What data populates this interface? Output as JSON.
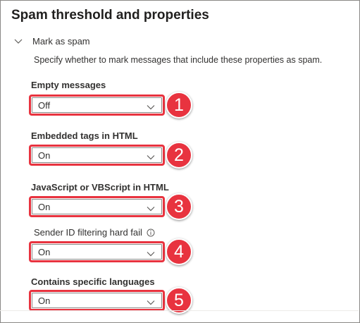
{
  "panel": {
    "title": "Spam threshold and properties"
  },
  "section": {
    "label": "Mark as spam",
    "description": "Specify whether to mark messages that include these properties as spam."
  },
  "fields": [
    {
      "label": "Empty messages",
      "value": "Off",
      "badge": "1"
    },
    {
      "label": "Embedded tags in HTML",
      "value": "On",
      "badge": "2"
    },
    {
      "label": "JavaScript or VBScript in HTML",
      "value": "On",
      "badge": "3"
    },
    {
      "label": "Sender ID filtering hard fail",
      "value": "On",
      "badge": "4"
    },
    {
      "label": "Contains specific languages",
      "value": "On",
      "badge": "5"
    }
  ],
  "colors": {
    "highlight": "#e8333f",
    "text": "#323130",
    "border": "#8a8886"
  },
  "icons": {
    "section_toggle": "chevron-down-icon",
    "dropdown_caret": "chevron-down-icon",
    "info": "info-icon"
  }
}
